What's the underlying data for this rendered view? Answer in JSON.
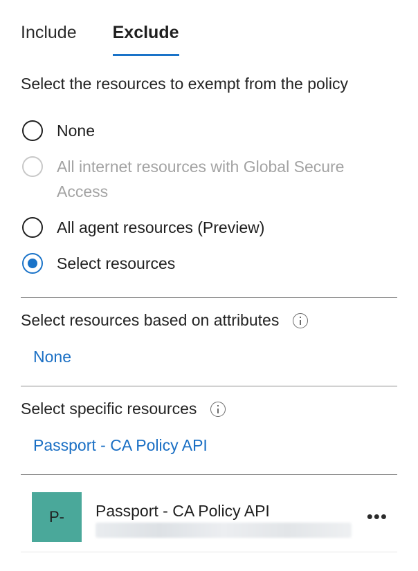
{
  "tabs": [
    {
      "label": "Include",
      "active": false
    },
    {
      "label": "Exclude",
      "active": true
    }
  ],
  "heading": "Select the resources to exempt from the policy",
  "options": [
    {
      "label": "None",
      "state": "unchecked"
    },
    {
      "label": "All internet resources with Global Secure Access",
      "state": "disabled"
    },
    {
      "label": "All agent resources (Preview)",
      "state": "unchecked"
    },
    {
      "label": "Select resources",
      "state": "checked"
    }
  ],
  "attributes_section": {
    "title": "Select resources based on attributes",
    "value": "None"
  },
  "specific_section": {
    "title": "Select specific resources",
    "value": "Passport - CA Policy API"
  },
  "selected_resource": {
    "initials": "P-",
    "name": "Passport - CA Policy API",
    "avatar_color": "#4aa89a",
    "more_icon": "more-horizontal-icon"
  },
  "colors": {
    "accent": "#1a73c8",
    "link": "#1a6fc4"
  }
}
